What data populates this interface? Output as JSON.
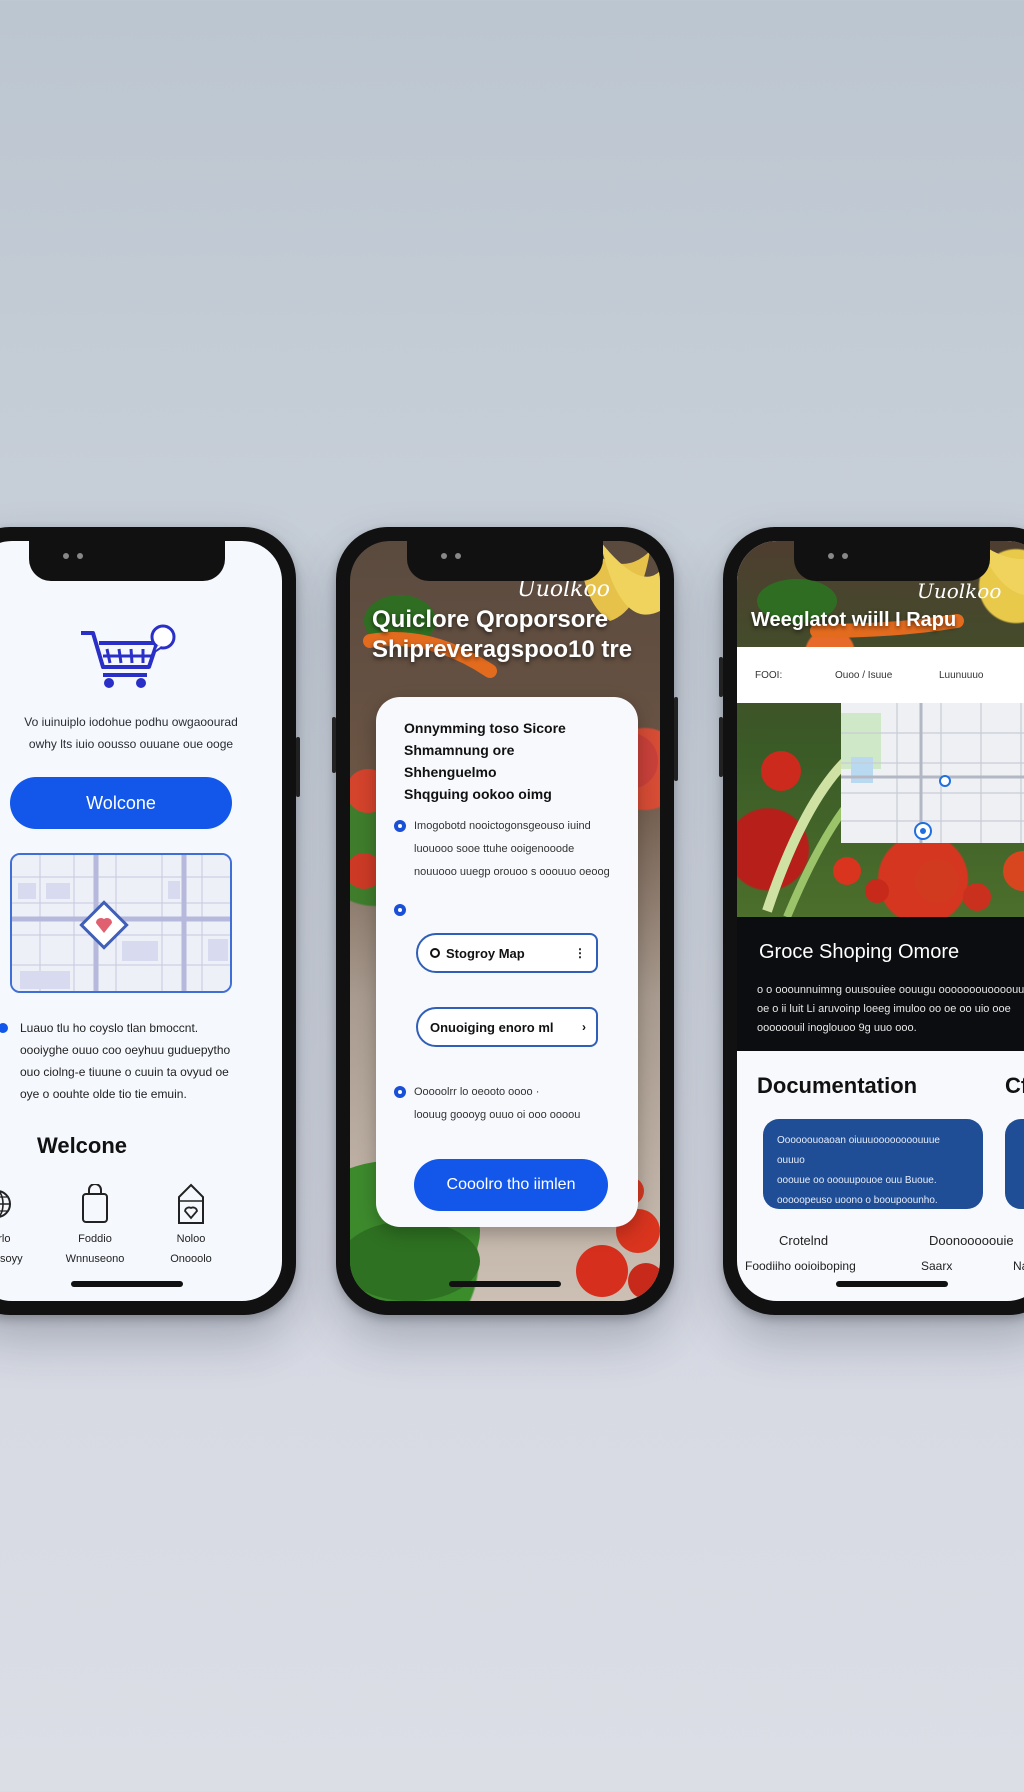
{
  "phone1": {
    "intro_text": [
      "Vo iuinuiplo iodohue podhu owgaoourad",
      "owhy lts iuio oousso ouuane oue ooge"
    ],
    "welcome_button": "Wolcone",
    "info_text": [
      "Luauo tlu ho coyslo tlan bmoccnt.",
      "oooiyghe ouuo coo oeyhuu guduepytho",
      "ouo ciolng-e tiuune o cuuin ta ovyud oe",
      "oye o oouhte olde tio tie emuin."
    ],
    "welcome_heading": "Welcone",
    "nav": [
      {
        "icon": "globe-icon",
        "label1": "Onrlo",
        "label2": "Wodesoyy"
      },
      {
        "icon": "bag-icon",
        "label1": "Foddio",
        "label2": "Wnnuseono"
      },
      {
        "icon": "store-icon",
        "label1": "Noloo",
        "label2": "Onooolo"
      }
    ]
  },
  "phone2": {
    "script_logo": "Uuolkoo",
    "hero_title": [
      "Quiclore Qroporsore",
      "Shipreveragspoo10 tre"
    ],
    "card_title": [
      "Onnymming toso Sicore",
      "Shmamnung ore",
      "Shhenguelmo",
      "Shqguing ookoo oimg"
    ],
    "bullet1": [
      "Imogobotd nooictogonsgeouso iuind",
      "luouooo sooe ttuhe ooigenooode",
      "nouuooo uuegp orouoo s ooouuo oeoog"
    ],
    "button1": "Stogroy Map",
    "button2": "Onuoiging enoro ml",
    "bullet3": [
      "Ooooolrr lo oeooto oooo ·",
      "loouug goooyg ouuo oi ooo oooou"
    ],
    "cta_button": "Cooolro tho iimlen"
  },
  "phone3": {
    "script_logo": "Uuolkoo",
    "title": "Weeglatot wiill I Rapu",
    "bar_items": [
      "FOOI:",
      "Ouoo / Isuue",
      "Luunuuuo"
    ],
    "heading": "Groce Shoping Omore",
    "body": [
      "o o ooounnuimng ouusouiee oouugu ooooooouoooouue.",
      "oe o ii luit Li aruvoinp loeeg imuloo oo oe oo uio ooe",
      "oooooouil inoglouoo 9g uuo ooo."
    ],
    "doc_title": "Documentation",
    "doc_title2": "Cf",
    "doc_card": [
      "Oooooouoaoan oiuuuoooooooouuue ouuuo",
      "ooouue oo ooouupouoe ouu Buoue.",
      "ooooopeuso uoono o booupoounho."
    ],
    "foot_row1": [
      "Crotelnd",
      "Doonooooouie"
    ],
    "foot_row2": [
      "Foodiiho ooioiboping",
      "Saarx",
      "Nab"
    ]
  },
  "colors": {
    "accent": "#1257ea",
    "doc_card": "#1f4e96",
    "phone_frame": "#111111"
  }
}
